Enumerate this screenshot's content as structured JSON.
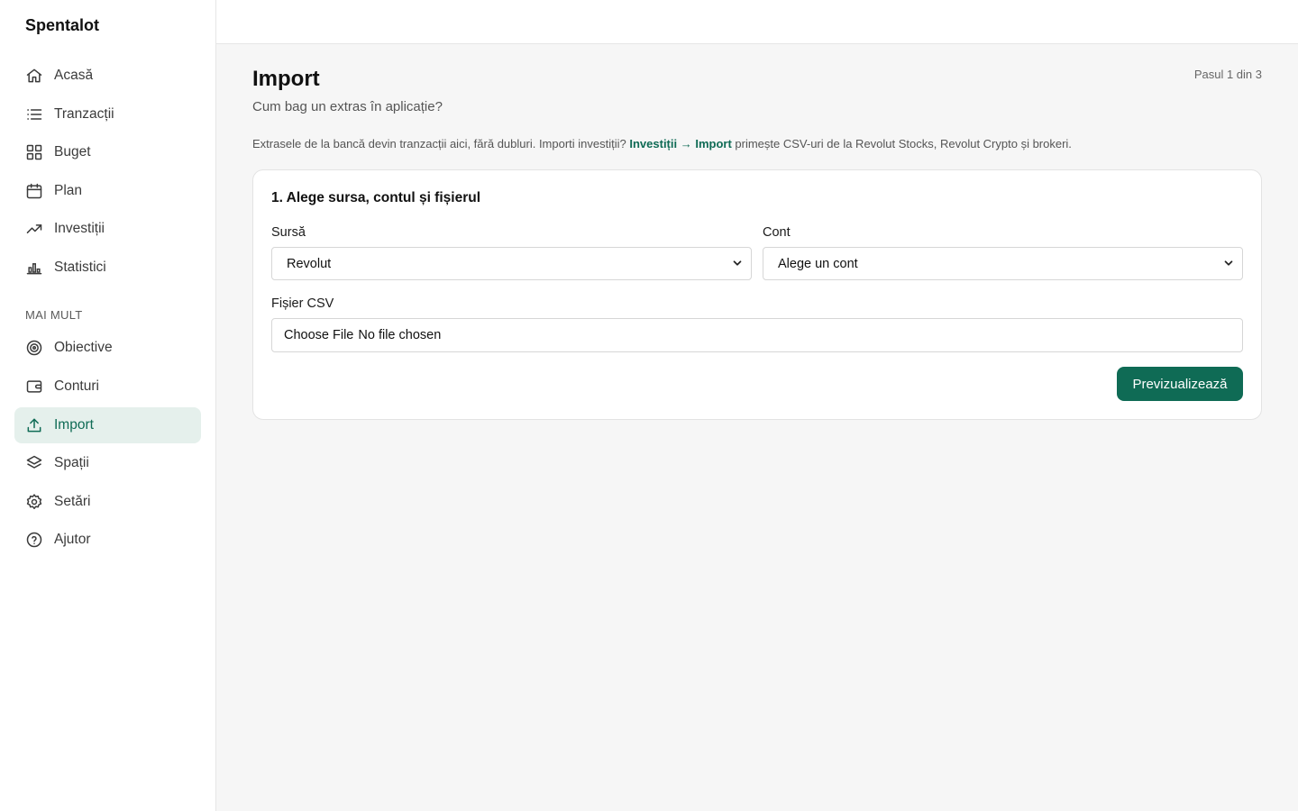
{
  "app": {
    "name": "Spentalot"
  },
  "sidebar": {
    "items": [
      {
        "label": "Acasă",
        "icon": "home-icon"
      },
      {
        "label": "Tranzacții",
        "icon": "list-icon"
      },
      {
        "label": "Buget",
        "icon": "grid-icon"
      },
      {
        "label": "Plan",
        "icon": "calendar-icon"
      },
      {
        "label": "Investiții",
        "icon": "trending-up-icon"
      },
      {
        "label": "Statistici",
        "icon": "bar-chart-icon"
      }
    ],
    "section_title": "MAI MULT",
    "more_items": [
      {
        "label": "Obiective",
        "icon": "target-icon"
      },
      {
        "label": "Conturi",
        "icon": "wallet-icon"
      },
      {
        "label": "Import",
        "icon": "upload-icon",
        "active": true
      },
      {
        "label": "Spații",
        "icon": "layers-icon"
      },
      {
        "label": "Setări",
        "icon": "gear-icon"
      },
      {
        "label": "Ajutor",
        "icon": "help-icon"
      }
    ]
  },
  "page": {
    "title": "Import",
    "subtitle": "Cum bag un extras în aplicație?",
    "step": "Pasul 1 din 3",
    "info_before": "Extrasele de la bancă devin tranzacții aici, fără dubluri. Importi investiții? ",
    "info_link": "Investiții → Import",
    "info_after": " primește CSV-uri de la Revolut Stocks, Revolut Crypto și brokeri."
  },
  "card": {
    "title": "1. Alege sursa, contul și fișierul",
    "source_label": "Sursă",
    "source_value": "Revolut",
    "account_label": "Cont",
    "account_value": "Alege un cont",
    "file_label": "Fișier CSV",
    "file_button": "Choose File",
    "file_status": "No file chosen",
    "submit_label": "Previzualizează"
  },
  "colors": {
    "accent": "#0f6b55",
    "active_bg": "#e5f0ec",
    "page_bg": "#f6f6f6"
  }
}
